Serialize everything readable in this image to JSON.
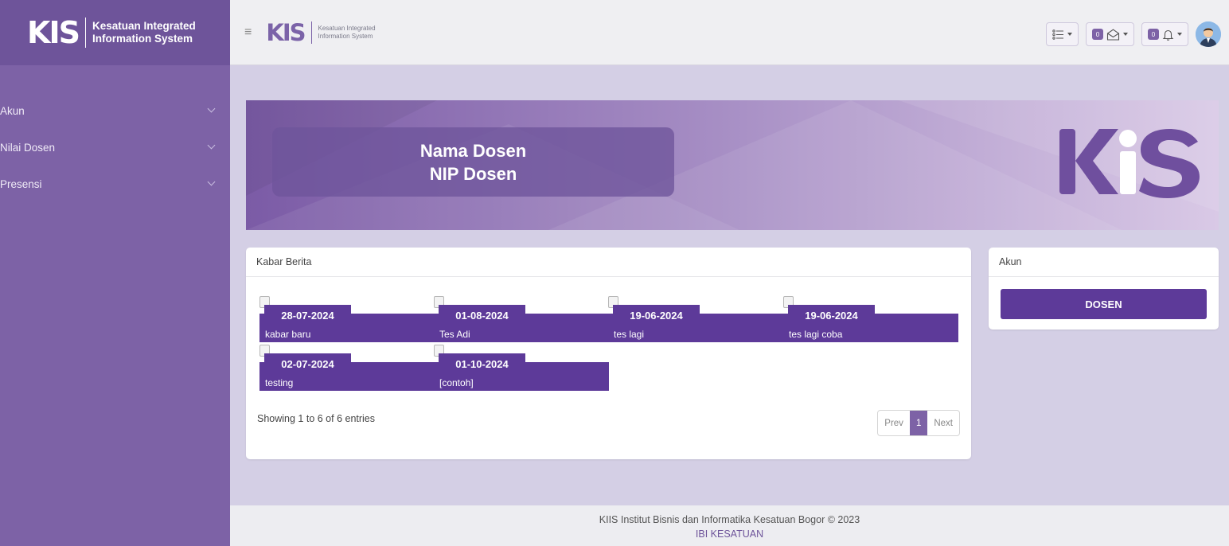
{
  "brand": {
    "logo_mark": "KIS",
    "line1": "Kesatuan Integrated",
    "line2": "Information System"
  },
  "sidebar": {
    "items": [
      {
        "label": "Akun"
      },
      {
        "label": "Nilai Dosen"
      },
      {
        "label": "Presensi"
      }
    ]
  },
  "header": {
    "menu_icon": "hamburger-icon",
    "mail_count": "0",
    "notif_count": "0",
    "icons": [
      "list-icon",
      "envelope-open-icon",
      "bell-icon",
      "user-avatar"
    ]
  },
  "banner": {
    "name": "Nama Dosen",
    "nip": "NIP Dosen",
    "logo": "KIS"
  },
  "news": {
    "title": "Kabar Berita",
    "items": [
      {
        "date": "28-07-2024",
        "caption": "kabar baru"
      },
      {
        "date": "01-08-2024",
        "caption": "Tes Adi"
      },
      {
        "date": "19-06-2024",
        "caption": "tes lagi"
      },
      {
        "date": "19-06-2024",
        "caption": "tes lagi coba"
      },
      {
        "date": "02-07-2024",
        "caption": "testing"
      },
      {
        "date": "01-10-2024",
        "caption": "[contoh]"
      }
    ],
    "showing": "Showing 1 to 6 of 6 entries",
    "pager": {
      "prev": "Prev",
      "page": "1",
      "next": "Next"
    }
  },
  "akun": {
    "title": "Akun",
    "button": "DOSEN"
  },
  "footer": {
    "line1": "KIIS Institut Bisnis dan Informatika Kesatuan Bogor © 2023",
    "line2": "IBI KESATUAN"
  },
  "colors": {
    "sidebar": "#7d62a6",
    "accent": "#5d3a99",
    "content_bg": "#d4cfe5"
  }
}
